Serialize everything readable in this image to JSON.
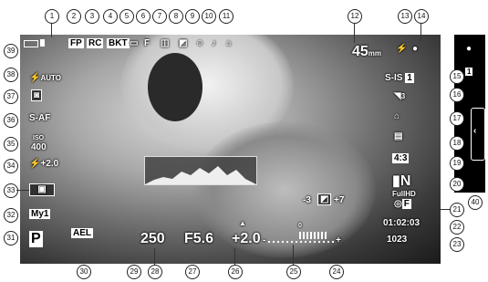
{
  "callouts": [
    "1",
    "2",
    "3",
    "4",
    "5",
    "6",
    "7",
    "8",
    "9",
    "10",
    "11",
    "12",
    "13",
    "14",
    "15",
    "16",
    "17",
    "18",
    "19",
    "20",
    "21",
    "22",
    "23",
    "24",
    "25",
    "26",
    "27",
    "28",
    "29",
    "30",
    "31",
    "32",
    "33",
    "34",
    "35",
    "36",
    "37",
    "38",
    "39",
    "40"
  ],
  "top": {
    "fp": "FP",
    "rc": "RC",
    "bkt": "BKT",
    "focal_value": "45",
    "focal_unit": "mm"
  },
  "left": {
    "flash": "AUTO",
    "af_mode": "S-AF",
    "iso_label": "ISO",
    "iso_value": "400",
    "flash_comp": "+2.0",
    "myset": "My1",
    "mode": "P"
  },
  "right": {
    "is": "S-IS",
    "is_mode": "1",
    "drive_num": "3",
    "aspect": "4:3",
    "quality": "N",
    "video_res": "FullHD",
    "video_fmt": "F",
    "rec_time": "01:02:03",
    "shots": "1023"
  },
  "bottom": {
    "ael": "AEL",
    "shutter": "250",
    "aperture": "F5.6",
    "exposure": "+2.0",
    "hl_minus": "-3",
    "hl_plus": "+7",
    "meter_zero": "0",
    "meter_minus": "-",
    "meter_plus": "+"
  },
  "strip": {
    "mode": "1"
  },
  "colors": {
    "lcd_text": "#ffffff",
    "strip_bg": "#000000",
    "page_bg": "#ffffff"
  }
}
